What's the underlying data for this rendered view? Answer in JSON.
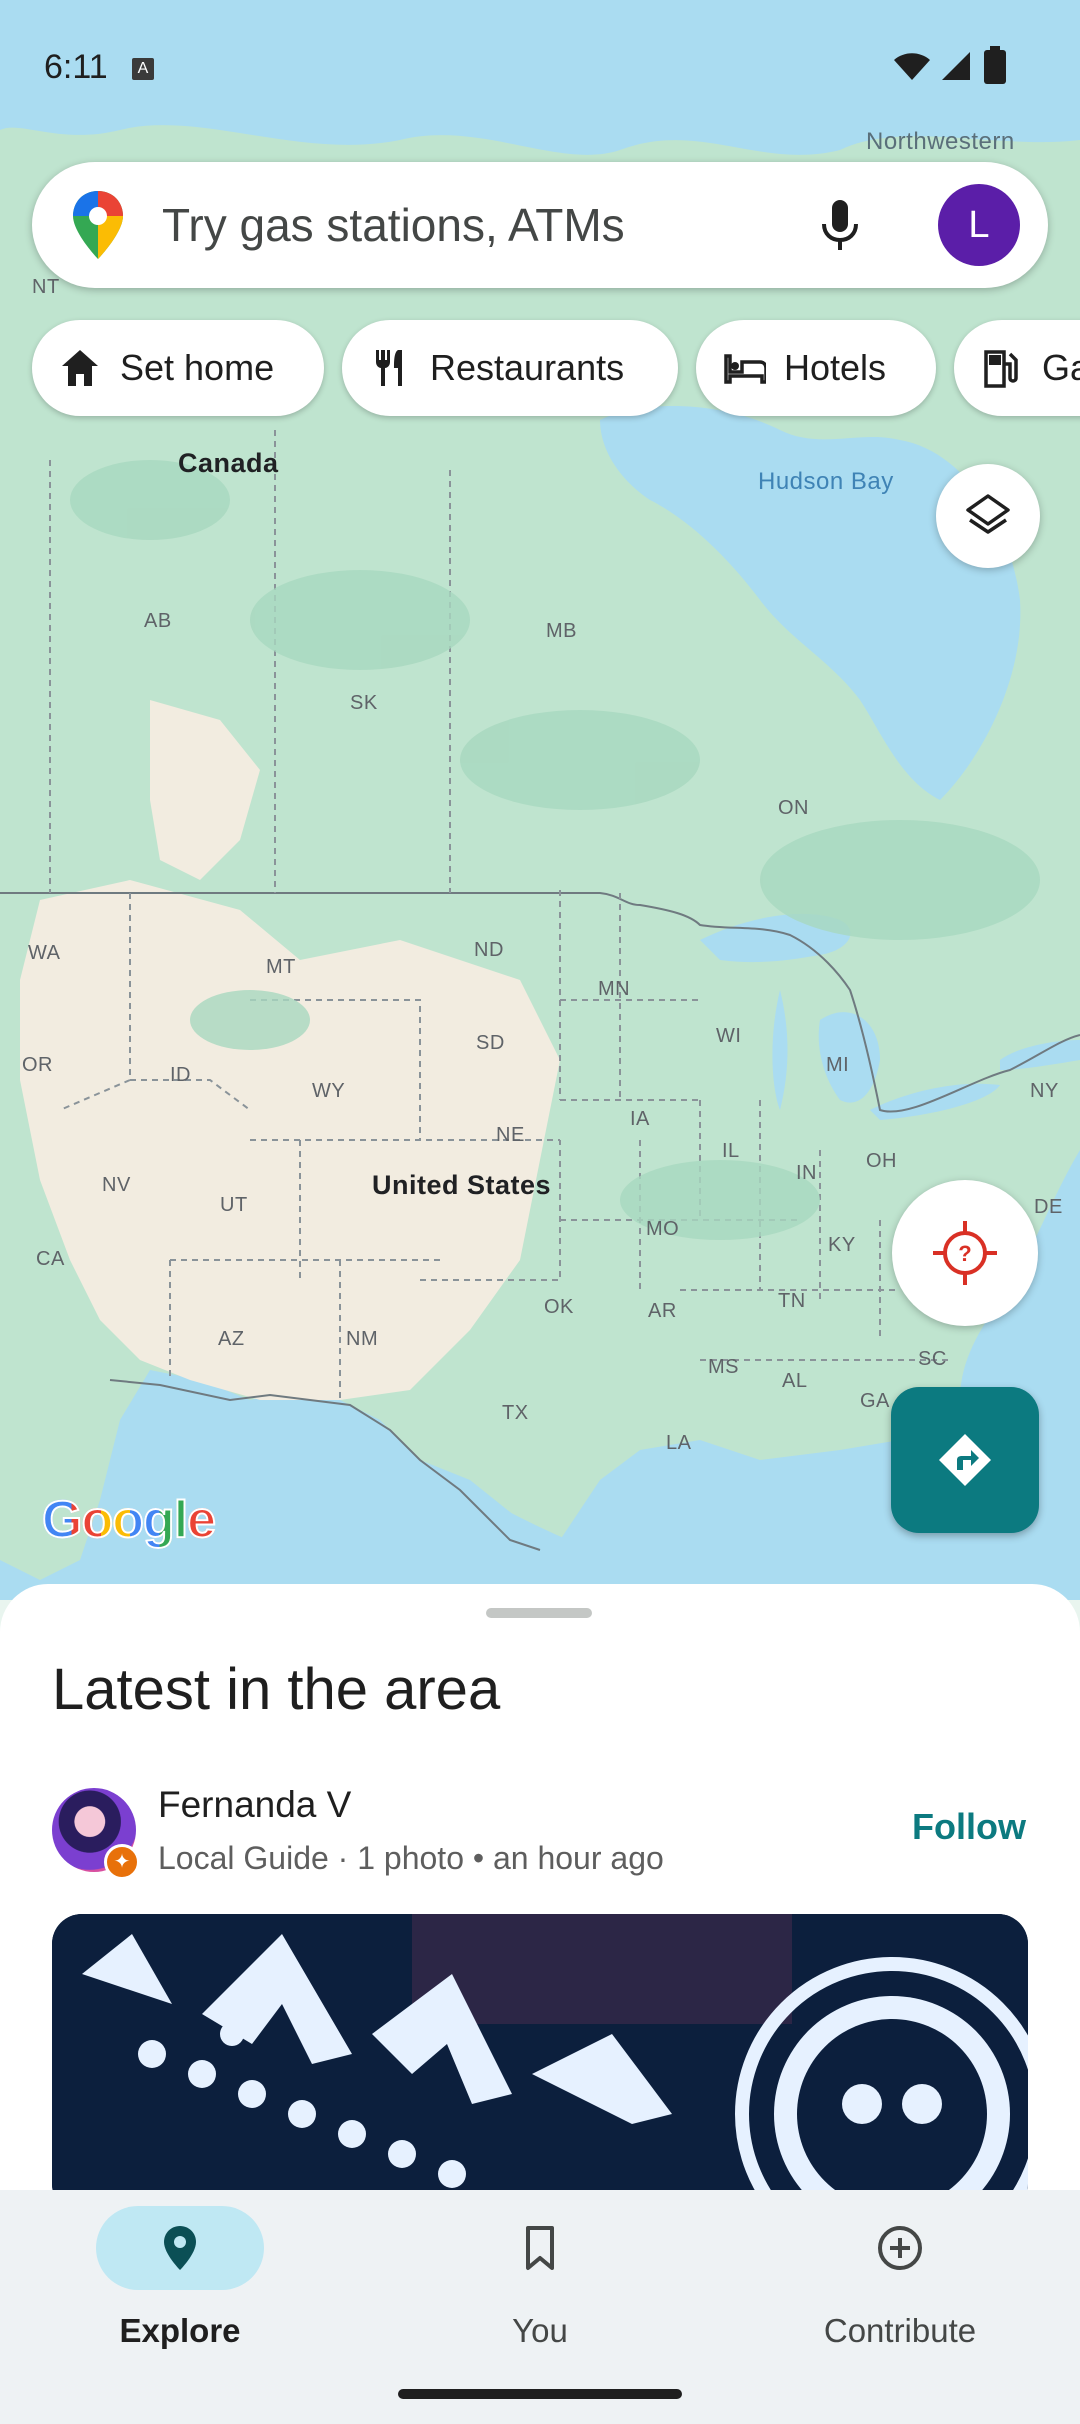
{
  "status_bar": {
    "time": "6:11",
    "notification_icon": "A"
  },
  "search": {
    "placeholder": "Try gas stations, ATMs",
    "avatar_initial": "L"
  },
  "chips": [
    {
      "label": "Set home",
      "icon": "home-icon"
    },
    {
      "label": "Restaurants",
      "icon": "restaurant-icon"
    },
    {
      "label": "Hotels",
      "icon": "hotel-icon"
    },
    {
      "label": "Ga",
      "icon": "gas-station-icon"
    }
  ],
  "map": {
    "labels": {
      "northwestern": "Northwestern",
      "nt": "NT",
      "canada": "Canada",
      "hudson_bay": "Hudson Bay",
      "ab": "AB",
      "mb": "MB",
      "sk": "SK",
      "on": "ON",
      "wa": "WA",
      "mt": "MT",
      "nd": "ND",
      "mn": "MN",
      "or": "OR",
      "id": "ID",
      "wy": "WY",
      "sd": "SD",
      "wi": "WI",
      "mi": "MI",
      "ny": "NY",
      "ia": "IA",
      "ne": "NE",
      "il": "IL",
      "in": "IN",
      "oh": "OH",
      "nv": "NV",
      "ut": "UT",
      "united_states": "United States",
      "de": "DE",
      "ca": "CA",
      "mo": "MO",
      "ky": "KY",
      "ok": "OK",
      "ar": "AR",
      "tn": "TN",
      "az": "AZ",
      "nm": "NM",
      "ms": "MS",
      "al": "AL",
      "sc": "SC",
      "tx": "TX",
      "la": "LA",
      "ga": "GA"
    },
    "google_logo": "Google"
  },
  "sheet": {
    "heading": "Latest in the area",
    "post": {
      "author": "Fernanda V",
      "meta": "Local Guide · 1 photo  •  an hour ago",
      "follow_label": "Follow"
    }
  },
  "bottom_nav": [
    {
      "label": "Explore",
      "icon": "explore-pin-icon",
      "active": true
    },
    {
      "label": "You",
      "icon": "bookmark-icon",
      "active": false
    },
    {
      "label": "Contribute",
      "icon": "add-circle-icon",
      "active": false
    }
  ]
}
